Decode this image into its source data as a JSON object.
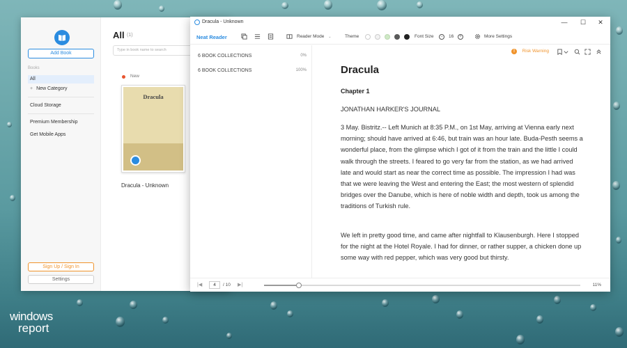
{
  "library": {
    "add_book": "Add Book",
    "sections": {
      "books": "Books"
    },
    "sidebar_items": [
      "All",
      "New Category",
      "Cloud Storage",
      "Premium Membership",
      "Get Mobile Apps"
    ],
    "sign_in": "Sign Up / Sign In",
    "settings": "Settings",
    "title": "All",
    "count": "(1)",
    "search_placeholder": "Type in book name to search",
    "new_label": "New",
    "book": {
      "cover_title": "Dracula",
      "caption": "Dracula - Unknown"
    }
  },
  "reader": {
    "window_title": "Dracula - Unknown",
    "window_buttons": [
      "—",
      "☐",
      "✕"
    ],
    "toolbar": {
      "brand": "Neat Reader",
      "reader_mode": "Reader Mode",
      "theme": "Theme",
      "font_size_label": "Font Size",
      "font_size_value": "16",
      "more_settings": "More Settings"
    },
    "theme_colors": [
      "#ffffff",
      "#f3f3f3",
      "#cfe9c6",
      "#5a5a5a",
      "#222222"
    ],
    "toc": [
      {
        "label": "6 BOOK COLLECTIONS",
        "pct": "0%"
      },
      {
        "label": "6 BOOK COLLECTIONS",
        "pct": "100%"
      }
    ],
    "risk_warning": "Risk Warning",
    "content": {
      "title": "Dracula",
      "chapter": "Chapter 1",
      "paragraphs": [
        "JONATHAN HARKER'S JOURNAL",
        "3 May. Bistritz.-- Left Munich at 8:35 P.M., on 1st May, arriving at Vienna early next morning; should have arrived at 6:46, but train was an hour late. Buda-Pesth seems a wonderful place, from the glimpse which I got of it from the train and the little I could walk through the streets. I feared to go very far from the station, as we had arrived late and would start as near the correct time as possible. The impression I had was that we were leaving the West and entering the East; the most western of splendid bridges over the Danube, which is here of noble width and depth, took us among the traditions of Turkish rule.",
        "We left in pretty good time, and came after nightfall to Klausenburgh. Here I stopped for the night at the Hotel Royale. I had for dinner, or rather supper, a chicken done up some way with red pepper, which was very good but thirsty."
      ]
    },
    "footer": {
      "first_arrow": "|◀",
      "last_arrow": "▶|",
      "page_current": "4",
      "page_total": "/ 10",
      "progress_percent": 11,
      "progress_label": "11%"
    }
  },
  "watermark": {
    "line1": "windows",
    "line2": "report"
  }
}
